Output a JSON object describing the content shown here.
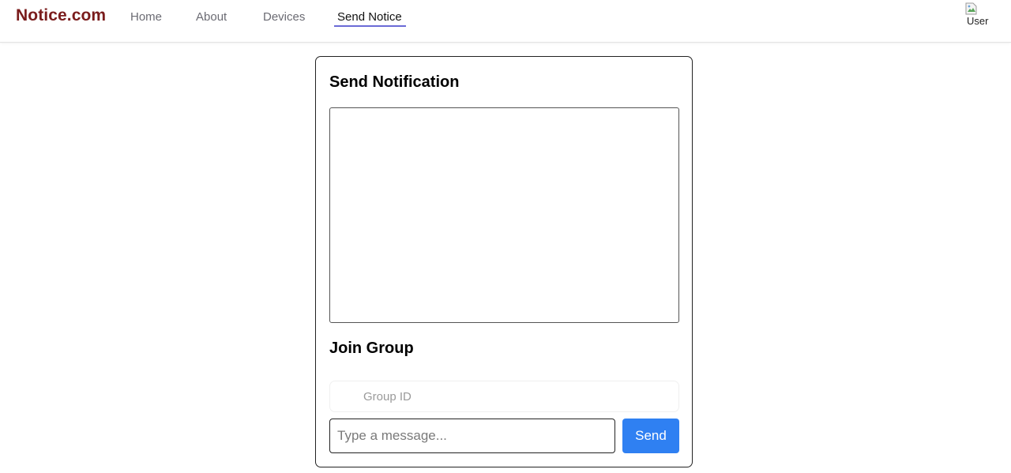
{
  "navbar": {
    "brand": "Notice.com",
    "links": [
      {
        "label": "Home"
      },
      {
        "label": "About"
      },
      {
        "label": "Devices"
      },
      {
        "label": "Send Notice",
        "active": true
      }
    ],
    "avatar_alt": "User"
  },
  "card": {
    "send_title": "Send Notification",
    "notice_text": "",
    "join_title": "Join Group",
    "group_id_placeholder": "Group ID",
    "group_id_value": "",
    "message_placeholder": "Type a message...",
    "message_value": "",
    "send_label": "Send"
  },
  "colors": {
    "brand": "#7a1c1c",
    "active_underline": "#6a6ad6",
    "send_button": "#2f80f2"
  }
}
